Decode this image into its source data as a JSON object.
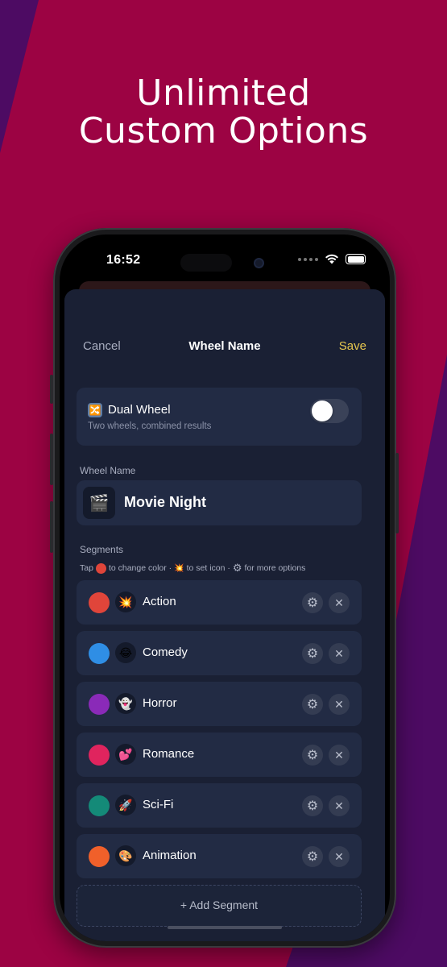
{
  "headline": {
    "line1": "Unlimited",
    "line2": "Custom Options"
  },
  "status_bar": {
    "time": "16:52"
  },
  "nav": {
    "cancel": "Cancel",
    "title": "Wheel Name",
    "save": "Save"
  },
  "dual_wheel": {
    "icon": "🔀",
    "title": "Dual Wheel",
    "subtitle": "Two wheels, combined results",
    "enabled": false
  },
  "wheel_name": {
    "label": "Wheel Name",
    "emoji": "🎬",
    "value": "Movie Night"
  },
  "segments": {
    "label": "Segments",
    "hint": {
      "part1": "Tap",
      "part2": "to change color ·",
      "icon_emoji": "💥",
      "part3": "to set icon ·",
      "gear": "⚙",
      "part4": "for more options"
    },
    "items": [
      {
        "label": "Action",
        "emoji": "💥",
        "color": "#e0453a"
      },
      {
        "label": "Comedy",
        "emoji": "😂",
        "color": "#2f8ee5"
      },
      {
        "label": "Horror",
        "emoji": "👻",
        "color": "#8a2ab8"
      },
      {
        "label": "Romance",
        "emoji": "💕",
        "color": "#e0245e"
      },
      {
        "label": "Sci-Fi",
        "emoji": "🚀",
        "color": "#148a78"
      },
      {
        "label": "Animation",
        "emoji": "🎨",
        "color": "#f0602a"
      }
    ],
    "add_label": "+ Add Segment"
  },
  "colors": {
    "background": "#9c0343",
    "accent_save": "#e8c84f",
    "card": "#222b44",
    "sheet": "#1a2034"
  }
}
